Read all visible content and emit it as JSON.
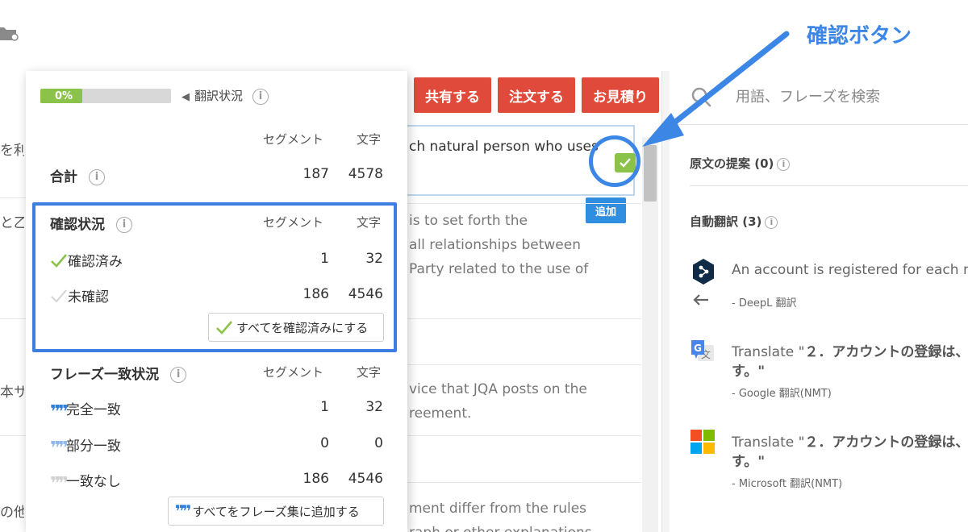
{
  "annotation": {
    "label": "確認ボタン",
    "color": "#3c86e6"
  },
  "toolbar": {
    "share_label": "共有する",
    "order_label": "注文する",
    "quote_label": "お見積り",
    "button_color": "#e04a3a"
  },
  "editor": {
    "left_fragments": [
      "を利",
      "と乙",
      "本サ",
      "の他"
    ],
    "active_segment_text": "ch natural person who uses",
    "add_label": "追加",
    "source_lines": [
      "is to set forth the",
      "all relationships between",
      "Party related to the use of",
      "vice that JQA posts on the",
      "reement.",
      "ment differ from the rules",
      "raph or other explanations"
    ]
  },
  "search": {
    "placeholder": "用語、フレーズを検索"
  },
  "right_panel": {
    "source_suggestions": "原文の提案 (0)",
    "auto_translation": "自動翻訳 (3)",
    "machine_translations": [
      {
        "icon": "deepl-icon",
        "text": "An account is registered for each nat",
        "source": "- DeepL 翻訳"
      },
      {
        "icon": "google-translate-icon",
        "prefix": "Translate \"",
        "highlight": "２．アカウントの登録は、",
        "line2": "す。\"",
        "source": "- Google 翻訳(NMT)"
      },
      {
        "icon": "microsoft-icon",
        "prefix": "Translate \"",
        "highlight": "２．アカウントの登録は、",
        "line2": "す。\"",
        "source": "- Microsoft 翻訳(NMT)"
      }
    ]
  },
  "popup": {
    "progress": {
      "value": 0,
      "label": "0%"
    },
    "status_title": "翻訳状況",
    "col_segment": "セグメント",
    "col_chars": "文字",
    "total": {
      "label": "合計",
      "segments": "187",
      "chars": "4578"
    },
    "confirmation": {
      "title": "確認状況",
      "confirmed": {
        "label": "確認済み",
        "segments": "1",
        "chars": "32"
      },
      "unconfirmed": {
        "label": "未確認",
        "segments": "186",
        "chars": "4546"
      },
      "confirm_all_label": "すべてを確認済みにする"
    },
    "phrase_match": {
      "title": "フレーズ一致状況",
      "exact": {
        "label": "完全一致",
        "segments": "1",
        "chars": "32"
      },
      "partial": {
        "label": "部分一致",
        "segments": "0",
        "chars": "0"
      },
      "none": {
        "label": "一致なし",
        "segments": "186",
        "chars": "4546"
      },
      "add_all_label": "すべてをフレーズ集に追加する"
    }
  }
}
